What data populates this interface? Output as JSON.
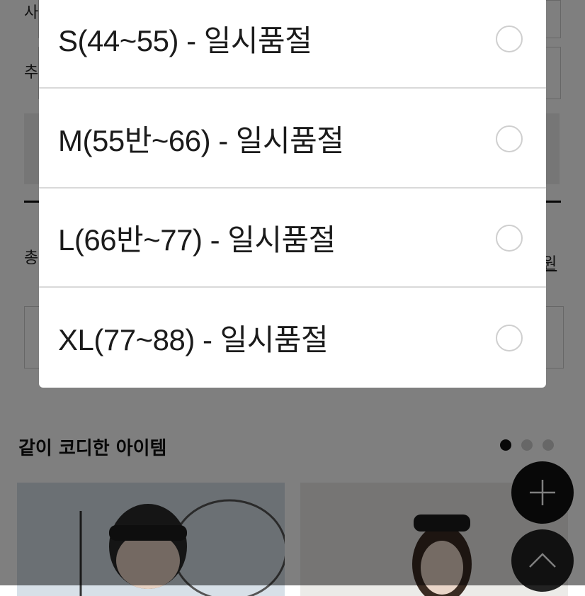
{
  "background": {
    "form_labels": [
      "사",
      "추",
      "총"
    ],
    "price_suffix": "원",
    "related_section_title": "같이 코디한 아이템",
    "carousel": {
      "pages": 3,
      "active_index": 0
    },
    "fab_add_icon": "plus-icon",
    "fab_top_icon": "chevron-up-icon"
  },
  "size_select": {
    "options": [
      {
        "label": "S(44~55) - 일시품절",
        "selected": false
      },
      {
        "label": "M(55반~66) - 일시품절",
        "selected": false
      },
      {
        "label": "L(66반~77) - 일시품절",
        "selected": false
      },
      {
        "label": "XL(77~88) - 일시품절",
        "selected": false
      }
    ]
  },
  "colors": {
    "overlay": "#000000",
    "text": "#1b1b1b",
    "divider": "#d9d9d9",
    "radio_border": "#cfcfcf"
  }
}
